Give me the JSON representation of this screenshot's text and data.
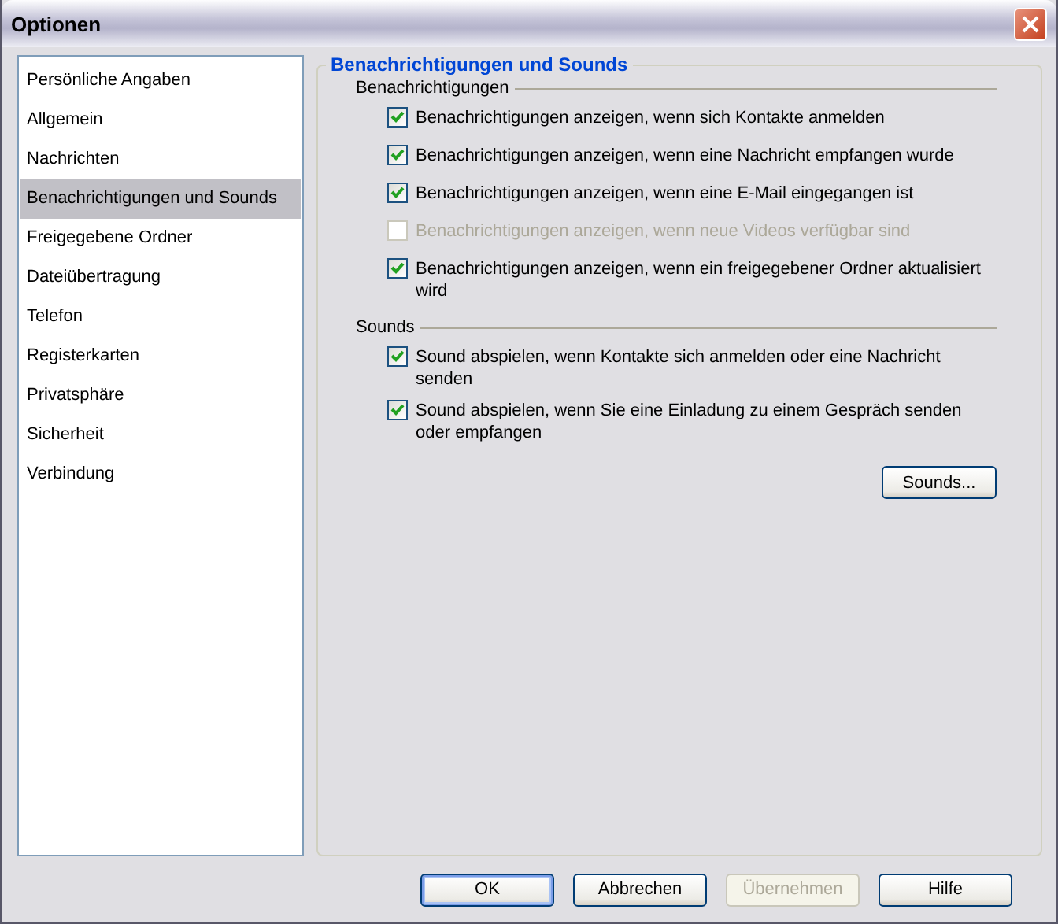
{
  "window": {
    "title": "Optionen"
  },
  "sidebar": {
    "items": [
      {
        "label": "Persönliche Angaben",
        "selected": false
      },
      {
        "label": "Allgemein",
        "selected": false
      },
      {
        "label": "Nachrichten",
        "selected": false
      },
      {
        "label": "Benachrichtigungen und Sounds",
        "selected": true
      },
      {
        "label": "Freigegebene Ordner",
        "selected": false
      },
      {
        "label": "Dateiübertragung",
        "selected": false
      },
      {
        "label": "Telefon",
        "selected": false
      },
      {
        "label": "Registerkarten",
        "selected": false
      },
      {
        "label": "Privatsphäre",
        "selected": false
      },
      {
        "label": "Sicherheit",
        "selected": false
      },
      {
        "label": "Verbindung",
        "selected": false
      }
    ]
  },
  "panel": {
    "title": "Benachrichtigungen und Sounds",
    "sections": [
      {
        "heading": "Benachrichtigungen",
        "options": [
          {
            "label": "Benachrichtigungen anzeigen, wenn sich Kontakte anmelden",
            "checked": true,
            "disabled": false
          },
          {
            "label": "Benachrichtigungen anzeigen, wenn eine Nachricht empfangen wurde",
            "checked": true,
            "disabled": false
          },
          {
            "label": "Benachrichtigungen anzeigen, wenn eine E-Mail eingegangen ist",
            "checked": true,
            "disabled": false
          },
          {
            "label": "Benachrichtigungen anzeigen, wenn neue Videos verfügbar sind",
            "checked": false,
            "disabled": true
          },
          {
            "label": "Benachrichtigungen anzeigen, wenn ein freigegebener Ordner aktualisiert wird",
            "checked": true,
            "disabled": false
          }
        ]
      },
      {
        "heading": "Sounds",
        "options": [
          {
            "label": "Sound abspielen, wenn Kontakte sich anmelden oder eine Nachricht senden",
            "checked": true,
            "disabled": false
          },
          {
            "label": "Sound abspielen, wenn Sie eine Einladung zu einem Gespräch senden oder empfangen",
            "checked": true,
            "disabled": false
          }
        ],
        "button": {
          "label": "Sounds..."
        }
      }
    ]
  },
  "buttons": [
    {
      "label": "OK",
      "default": true,
      "disabled": false
    },
    {
      "label": "Abbrechen",
      "default": false,
      "disabled": false
    },
    {
      "label": "Übernehmen",
      "default": false,
      "disabled": true
    },
    {
      "label": "Hilfe",
      "default": false,
      "disabled": false
    }
  ]
}
